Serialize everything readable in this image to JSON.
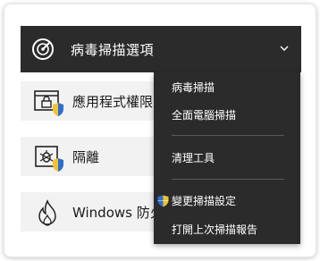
{
  "header": {
    "title": "病毒掃描選項",
    "icon": "radar-scan-icon",
    "chevron": "chevron-down-icon"
  },
  "rows": [
    {
      "label": "應用程式權限",
      "icon": "app-permission-lock-icon"
    },
    {
      "label": "隔離",
      "icon": "quarantine-bug-icon"
    },
    {
      "label": "Windows 防火牆",
      "icon": "firewall-flame-icon"
    }
  ],
  "menu": {
    "items": [
      {
        "label": "病毒掃描"
      },
      {
        "label": "全面電腦掃描"
      },
      {
        "label": "清理工具"
      },
      {
        "label": "變更掃描設定",
        "icon": "uac-shield-icon"
      },
      {
        "label": "打開上次掃描報告"
      }
    ]
  },
  "colors": {
    "header_bg": "#2b2b2b",
    "menu_bg": "#2b2b2b",
    "row_bg": "#f2f2f2",
    "shield_blue": "#2b6fd1",
    "shield_yellow": "#f2c230"
  }
}
